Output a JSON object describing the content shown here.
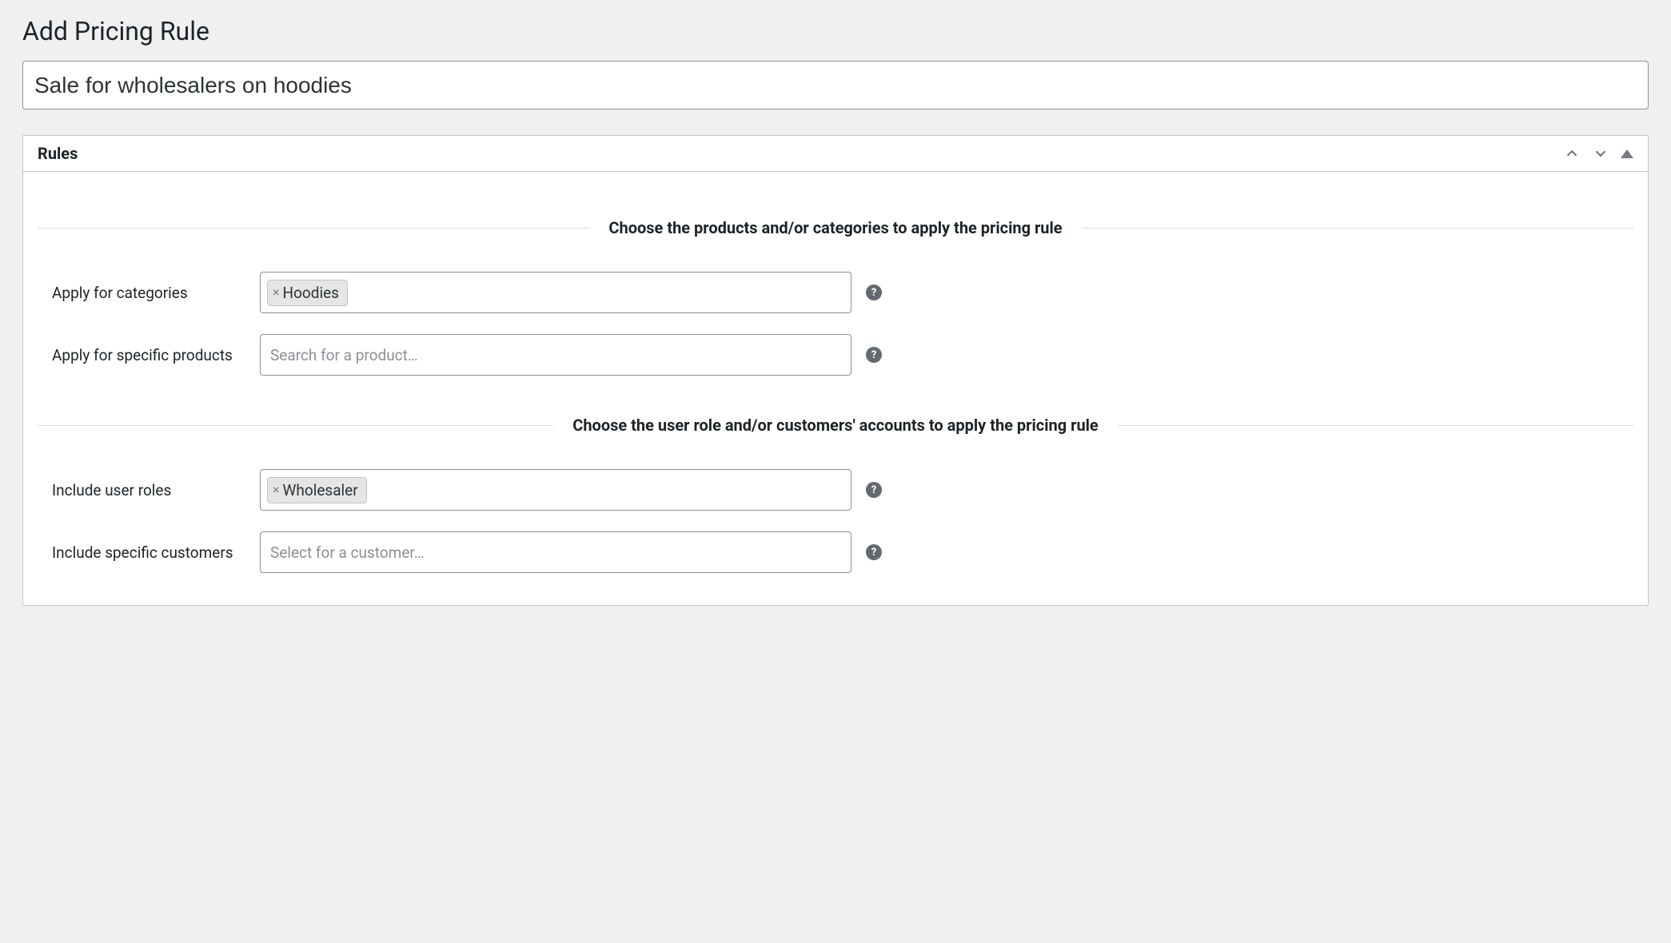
{
  "page": {
    "title": "Add Pricing Rule",
    "rule_name": "Sale for wholesalers on hoodies"
  },
  "panel": {
    "title": "Rules"
  },
  "sections": {
    "products_heading": "Choose the products and/or categories to apply the pricing rule",
    "users_heading": "Choose the user role and/or customers' accounts to apply the pricing rule"
  },
  "fields": {
    "categories": {
      "label": "Apply for categories",
      "tags": [
        "Hoodies"
      ]
    },
    "products": {
      "label": "Apply for specific products",
      "placeholder": "Search for a product…"
    },
    "user_roles": {
      "label": "Include user roles",
      "tags": [
        "Wholesaler"
      ]
    },
    "customers": {
      "label": "Include specific customers",
      "placeholder": "Select for a customer…"
    }
  }
}
